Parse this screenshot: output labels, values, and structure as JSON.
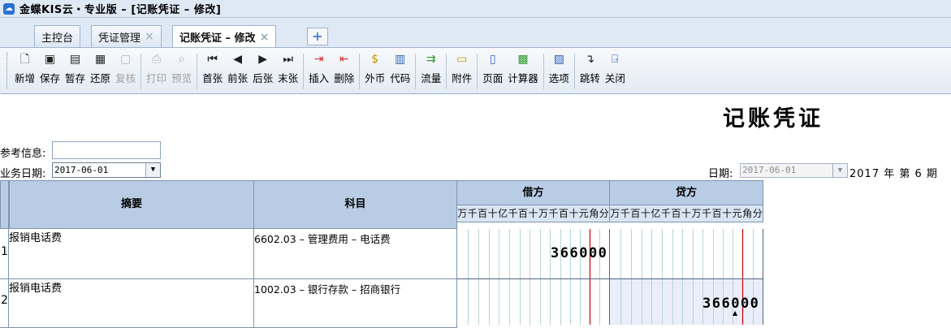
{
  "window": {
    "title": "金蝶KIS云・专业版 – [记账凭证 – 修改]",
    "icon": "kingdee-cloud-icon"
  },
  "tabs": [
    {
      "label": "主控台",
      "closable": false
    },
    {
      "label": "凭证管理",
      "closable": true
    },
    {
      "label": "记账凭证 – 修改",
      "closable": true,
      "active": true
    }
  ],
  "tab_close_glyph": "×",
  "tab_add_glyph": "+",
  "toolbar": {
    "buttons": [
      {
        "label": "新增",
        "icon": "new-document-icon",
        "enabled": true
      },
      {
        "label": "保存",
        "icon": "save-icon",
        "enabled": true
      },
      {
        "label": "暂存",
        "icon": "draft-save-icon",
        "enabled": true
      },
      {
        "label": "还原",
        "icon": "restore-icon",
        "enabled": true
      },
      {
        "label": "复核",
        "icon": "review-icon",
        "enabled": false
      },
      {
        "label": "打印",
        "icon": "print-icon",
        "enabled": false
      },
      {
        "label": "预览",
        "icon": "preview-icon",
        "enabled": false
      },
      {
        "label": "首张",
        "icon": "first-record-icon",
        "enabled": true
      },
      {
        "label": "前张",
        "icon": "previous-record-icon",
        "enabled": true
      },
      {
        "label": "后张",
        "icon": "next-record-icon",
        "enabled": true
      },
      {
        "label": "末张",
        "icon": "last-record-icon",
        "enabled": true
      },
      {
        "label": "插入",
        "icon": "insert-row-icon",
        "enabled": true
      },
      {
        "label": "删除",
        "icon": "delete-row-icon",
        "enabled": true
      },
      {
        "label": "外币",
        "icon": "foreign-currency-icon",
        "enabled": true
      },
      {
        "label": "代码",
        "icon": "code-book-icon",
        "enabled": true
      },
      {
        "label": "流量",
        "icon": "cash-flow-icon",
        "enabled": true
      },
      {
        "label": "附件",
        "icon": "attachment-folder-icon",
        "enabled": true
      },
      {
        "label": "页面",
        "icon": "page-book-icon",
        "enabled": true
      },
      {
        "label": "计算器",
        "icon": "calculator-icon",
        "enabled": true
      },
      {
        "label": "选项",
        "icon": "options-icon",
        "enabled": true
      },
      {
        "label": "跳转",
        "icon": "jump-arrow-icon",
        "enabled": true
      },
      {
        "label": "关闭",
        "icon": "close-door-icon",
        "enabled": true
      }
    ]
  },
  "voucher": {
    "title": "记账凭证",
    "reference_label": "参考信息:",
    "reference_value": "",
    "business_date_label": "业务日期:",
    "business_date": "2017-06-01",
    "date_label": "日期:",
    "date": "2017-06-01",
    "period_text": "2017 年 第 6 期"
  },
  "grid": {
    "headers": {
      "summary": "摘要",
      "account": "科目",
      "debit": "借方",
      "credit": "贷方"
    },
    "digit_units": [
      "万",
      "千",
      "百",
      "十",
      "亿",
      "千",
      "百",
      "十",
      "万",
      "千",
      "百",
      "十",
      "元",
      "角",
      "分"
    ],
    "rows": [
      {
        "no": "1",
        "summary": "报销电话费",
        "account": "6602.03 – 管理费用 – 电话费",
        "debit": "366000",
        "credit": ""
      },
      {
        "no": "2",
        "summary": "报销电话费",
        "account": "1002.03 – 银行存款 – 招商银行",
        "debit": "",
        "credit": "366000"
      }
    ]
  },
  "colors": {
    "header_bg": "#b8cce6",
    "yuan_line": "#cc0000",
    "credit_highlight": "#eaeefa"
  }
}
